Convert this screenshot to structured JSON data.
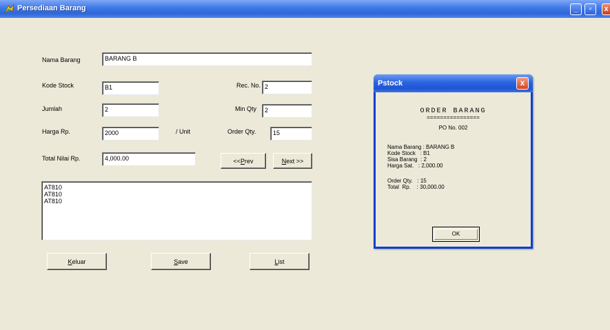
{
  "window": {
    "title": "Persediaan Barang",
    "controls": {
      "minimize": "_",
      "maximize": "▫",
      "close": "x"
    }
  },
  "form": {
    "nama_barang": {
      "label": "Nama Barang",
      "value": "BARANG B"
    },
    "kode_stock": {
      "label": "Kode Stock",
      "value": "B1"
    },
    "rec_no": {
      "label": "Rec. No.",
      "value": "2"
    },
    "jumlah": {
      "label": "Jumlah",
      "value": "2"
    },
    "min_qty": {
      "label": "Min Qty",
      "value": "2"
    },
    "harga": {
      "label": "Harga Rp.",
      "value": "2000",
      "unit": "/ Unit"
    },
    "order_qty": {
      "label": "Order Qty.",
      "value": "15"
    },
    "total_nilai": {
      "label": "Total Nilai Rp.",
      "value": "4,000.00"
    },
    "prev_button": {
      "prefix": "<< ",
      "access": "P",
      "rest": "rev"
    },
    "next_button": {
      "access": "N",
      "rest": "ext >>"
    },
    "list_items": [
      "AT810",
      "AT810",
      "AT810"
    ],
    "buttons": {
      "keluar": {
        "access": "K",
        "rest": "eluar"
      },
      "save": {
        "access": "S",
        "rest": "ave"
      },
      "list": {
        "access": "L",
        "rest": "ist"
      }
    }
  },
  "dialog": {
    "title": "Pstock",
    "close": "x",
    "heading": "ORDER BARANG",
    "underline": "================",
    "po": "PO No. 002",
    "details": [
      "Nama Barang : BARANG B",
      "Kode Stock   : B1",
      "Sisa Barang  : 2",
      "Harga Sat.   : 2,000.00"
    ],
    "summary": [
      "Order Qty.   : 15",
      "Total  Rp.    : 30,000.00"
    ],
    "ok_label": "OK"
  }
}
